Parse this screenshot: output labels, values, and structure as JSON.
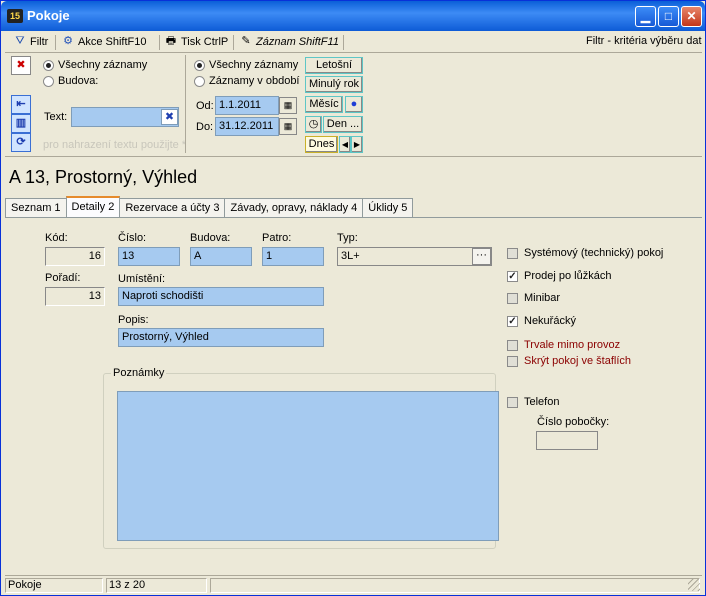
{
  "window": {
    "app_icon": "15",
    "title": "Pokoje",
    "buttons": [
      "minimize-icon",
      "maximize-icon",
      "close-icon"
    ]
  },
  "toolbar": {
    "filter": "Filtr",
    "actions": "Akce ShiftF10",
    "print": "Tisk CtrlP",
    "record": "Záznam ShiftF11",
    "hint": "Filtr - kritéria výběru dat"
  },
  "filter": {
    "scope": {
      "all": "Všechny záznamy",
      "building": "Budova:",
      "selected": "all"
    },
    "text_label": "Text:",
    "text_value": "",
    "replace_hint": "pro nahrazení textu použijte *",
    "period": {
      "all": "Všechny záznamy",
      "range": "Záznamy v období",
      "selected": "all"
    },
    "from_label": "Od:",
    "from_value": "1.1.2011",
    "to_label": "Do:",
    "to_value": "31.12.2011",
    "buttons": {
      "this_year": "Letošní",
      "last_year": "Minulý rok",
      "month": "Měsíc",
      "day": "Den ...",
      "today": "Dnes"
    }
  },
  "record_title": "A 13, Prostorný, Výhled",
  "tabs": [
    {
      "label": "Seznam 1",
      "active": false
    },
    {
      "label": "Detaily 2",
      "active": true
    },
    {
      "label": "Rezervace a účty 3",
      "active": false
    },
    {
      "label": "Závady, opravy, náklady 4",
      "active": false
    },
    {
      "label": "Úklidy 5",
      "active": false
    }
  ],
  "detail": {
    "code_label": "Kód:",
    "code_value": "16",
    "order_label": "Pořadí:",
    "order_value": "13",
    "number_label": "Číslo:",
    "number_value": "13",
    "building_label": "Budova:",
    "building_value": "A",
    "floor_label": "Patro:",
    "floor_value": "1",
    "type_label": "Typ:",
    "type_value": "3L+",
    "location_label": "Umístění:",
    "location_value": "Naproti schodišti",
    "description_label": "Popis:",
    "description_value": "Prostorný, Výhled",
    "notes_label": "Poznámky",
    "notes_value": ""
  },
  "options": [
    {
      "label": "Systémový (technický) pokoj",
      "checked": false,
      "style": "normal"
    },
    {
      "label": "Prodej po lůžkách",
      "checked": true,
      "style": "normal"
    },
    {
      "label": "Minibar",
      "checked": false,
      "style": "normal"
    },
    {
      "label": "Nekuřácký",
      "checked": true,
      "style": "normal"
    },
    {
      "label": "Trvale mimo provoz",
      "checked": false,
      "style": "red"
    },
    {
      "label": "Skrýt pokoj ve štaflích",
      "checked": false,
      "style": "red"
    }
  ],
  "phone": {
    "label": "Telefon",
    "checked": false,
    "extension_label": "Číslo pobočky:",
    "extension_value": ""
  },
  "status": {
    "module": "Pokoje",
    "position": "13 z 20",
    "extra": ""
  }
}
